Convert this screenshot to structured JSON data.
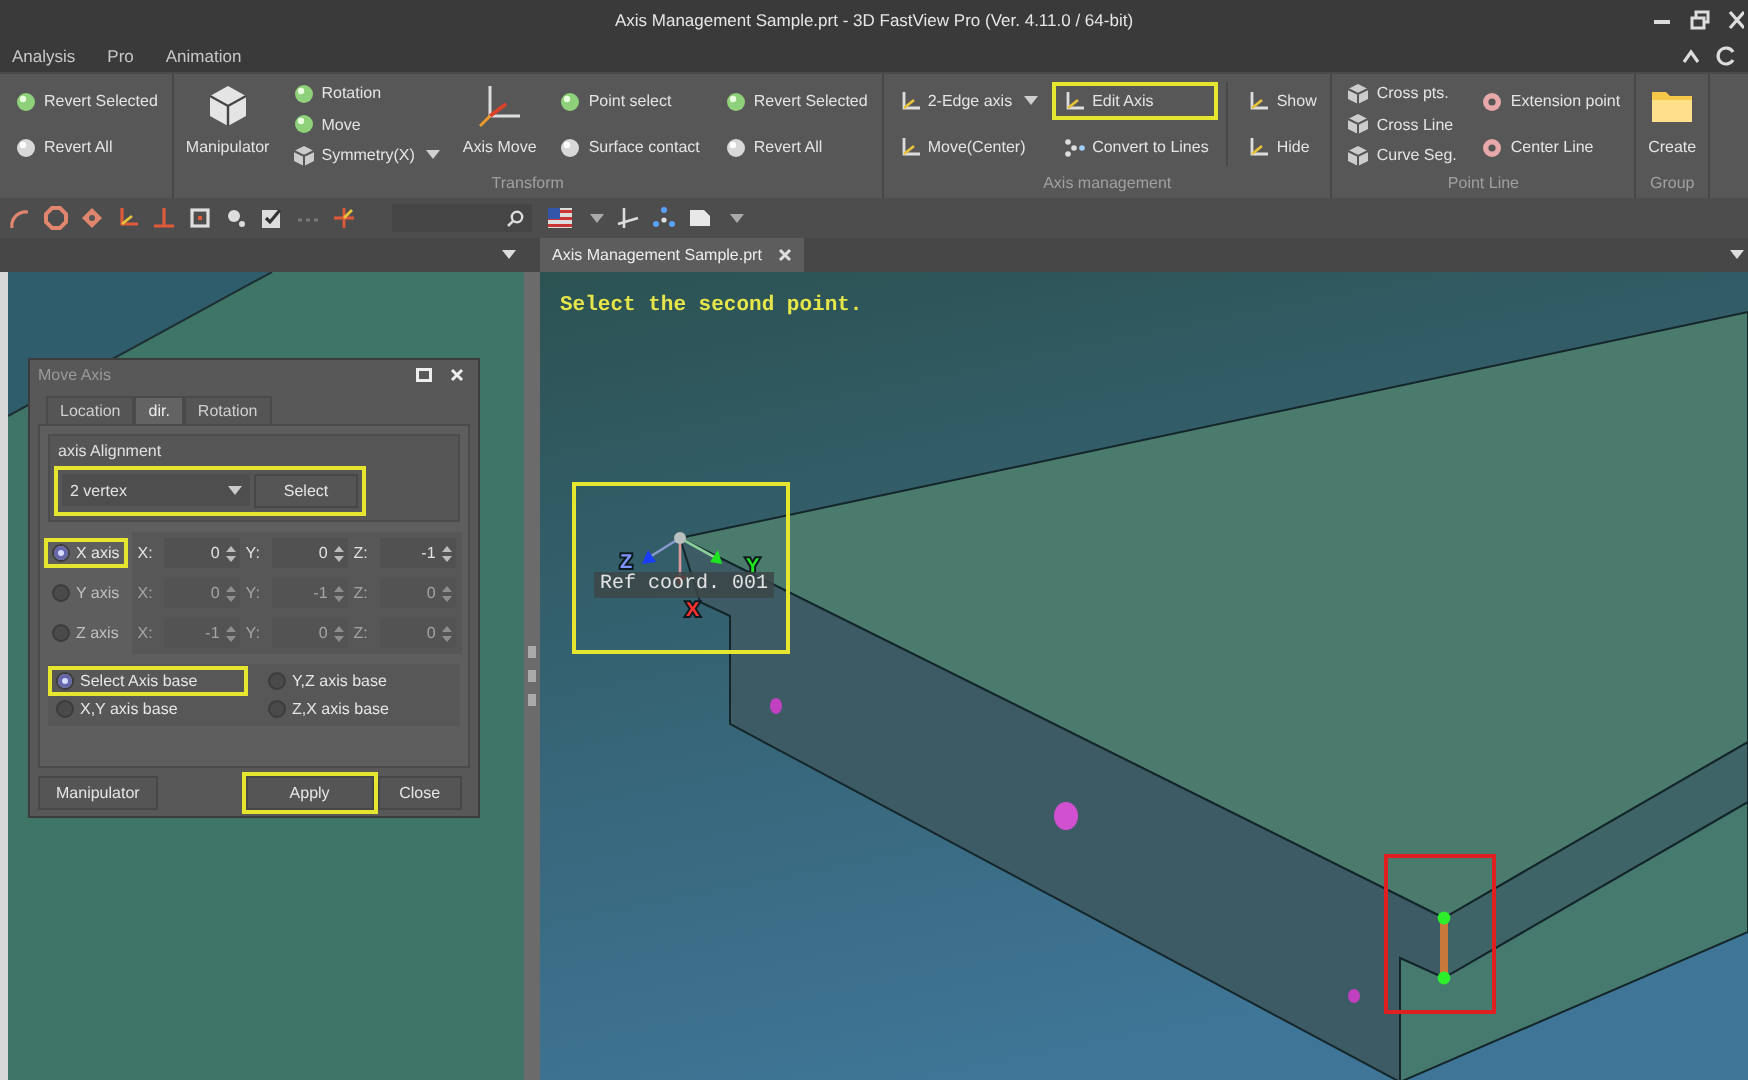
{
  "window": {
    "title": "Axis Management Sample.prt - 3D FastView Pro (Ver. 4.11.0 / 64-bit)"
  },
  "menu": [
    {
      "label": "Analysis"
    },
    {
      "label": "Pro"
    },
    {
      "label": "Animation"
    }
  ],
  "ribbon": [
    {
      "items": [
        {
          "kind": "stack",
          "buttons": [
            {
              "label": "Revert Selected",
              "dropdown": false,
              "highlighted": false
            },
            {
              "label": "Revert All",
              "dropdown": false,
              "highlighted": false
            }
          ]
        }
      ]
    },
    {
      "label": "Transform",
      "items": [
        {
          "kind": "large",
          "label": "Manipulator"
        },
        {
          "kind": "stack",
          "buttons": [
            {
              "label": "Rotation",
              "dropdown": false,
              "highlighted": false
            },
            {
              "label": "Move",
              "dropdown": false,
              "highlighted": false
            },
            {
              "label": "Symmetry(X)",
              "dropdown": true,
              "highlighted": false
            }
          ]
        },
        {
          "kind": "large",
          "label": "Axis Move"
        },
        {
          "kind": "stack",
          "buttons": [
            {
              "label": "Point select",
              "dropdown": false,
              "highlighted": false
            },
            {
              "label": "Surface contact",
              "dropdown": false,
              "highlighted": false
            }
          ]
        },
        {
          "kind": "stack",
          "buttons": [
            {
              "label": "Revert Selected",
              "dropdown": false,
              "highlighted": false
            },
            {
              "label": "Revert All",
              "dropdown": false,
              "highlighted": false
            }
          ]
        }
      ]
    },
    {
      "label": "Axis management",
      "items": [
        {
          "kind": "stack",
          "buttons": [
            {
              "label": "2-Edge axis",
              "dropdown": true,
              "highlighted": false
            },
            {
              "label": "Move(Center)",
              "dropdown": false,
              "highlighted": false
            }
          ]
        },
        {
          "kind": "stack",
          "buttons": [
            {
              "label": "Edit Axis",
              "dropdown": false,
              "highlighted": true
            },
            {
              "label": "Convert to Lines",
              "dropdown": false,
              "highlighted": false
            }
          ]
        },
        {
          "kind": "separator"
        },
        {
          "kind": "stack",
          "buttons": [
            {
              "label": "Show",
              "dropdown": false,
              "highlighted": false
            },
            {
              "label": "Hide",
              "dropdown": false,
              "highlighted": false
            }
          ]
        }
      ]
    },
    {
      "label": "Point Line",
      "items": [
        {
          "kind": "stack",
          "buttons": [
            {
              "label": "Cross pts.",
              "dropdown": false,
              "highlighted": false
            },
            {
              "label": "Cross Line",
              "dropdown": false,
              "highlighted": false
            },
            {
              "label": "Curve Seg.",
              "dropdown": false,
              "highlighted": false
            }
          ]
        },
        {
          "kind": "stack",
          "buttons": [
            {
              "label": "Extension point",
              "dropdown": false,
              "highlighted": false
            },
            {
              "label": "Center Line",
              "dropdown": false,
              "highlighted": false
            }
          ]
        }
      ]
    },
    {
      "label": "Group",
      "items": [
        {
          "kind": "large",
          "label": "Create"
        }
      ]
    }
  ],
  "document_tabs": [
    {
      "label": "Axis Management Sample.prt",
      "selected": true
    }
  ],
  "viewport": {
    "prompt": "Select the second point.",
    "coordinate_label": "Ref coord. 001",
    "axis_labels": [
      "Z",
      "Y",
      "X"
    ]
  },
  "dialog": {
    "title": "Move Axis",
    "tabs": [
      {
        "label": "Location",
        "selected": false
      },
      {
        "label": "dir.",
        "selected": true
      },
      {
        "label": "Rotation",
        "selected": false
      }
    ],
    "alignment": {
      "title": "axis Alignment",
      "method": "2 vertex",
      "button": "Select",
      "highlighted": true
    },
    "axes": [
      {
        "label": "X axis",
        "selected": true,
        "highlighted": true,
        "disabled": false,
        "coords": [
          {
            "label": "X:",
            "value": "0"
          },
          {
            "label": "Y:",
            "value": "0"
          },
          {
            "label": "Z:",
            "value": "-1"
          }
        ]
      },
      {
        "label": "Y axis",
        "selected": false,
        "highlighted": false,
        "disabled": true,
        "coords": [
          {
            "label": "X:",
            "value": "0"
          },
          {
            "label": "Y:",
            "value": "-1"
          },
          {
            "label": "Z:",
            "value": "0"
          }
        ]
      },
      {
        "label": "Z axis",
        "selected": false,
        "highlighted": false,
        "disabled": true,
        "coords": [
          {
            "label": "X:",
            "value": "-1"
          },
          {
            "label": "Y:",
            "value": "0"
          },
          {
            "label": "Z:",
            "value": "0"
          }
        ]
      }
    ],
    "bases": [
      {
        "label": "Select Axis base",
        "selected": true,
        "highlighted": true
      },
      {
        "label": "Y,Z axis base",
        "selected": false,
        "highlighted": false
      },
      {
        "label": "X,Y axis base",
        "selected": false,
        "highlighted": false
      },
      {
        "label": "Z,X axis base",
        "selected": false,
        "highlighted": false
      }
    ],
    "buttons": [
      {
        "label": "Manipulator",
        "highlighted": false
      },
      {
        "label": "Apply",
        "highlighted": true
      },
      {
        "label": "Close",
        "highlighted": false
      }
    ]
  }
}
